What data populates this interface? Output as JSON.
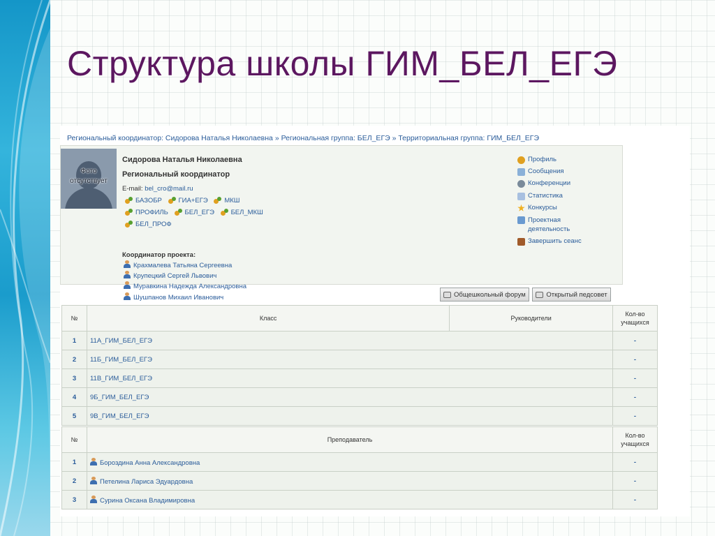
{
  "slide_title": "Структура школы ГИМ_БЕЛ_ЕГЭ",
  "breadcrumb": "Региональный координатор: Сидорова Наталья Николаевна » Региональная группа: БЕЛ_ЕГЭ » Территориальная группа: ГИМ_БЕЛ_ЕГЭ",
  "photo_caption_1": "Фото",
  "photo_caption_2": "отсутствует",
  "profile": {
    "name": "Сидорова Наталья Николаевна",
    "role": "Региональный координатор",
    "email_label": "E-mail: ",
    "email": "bel_cro@mail.ru",
    "groups": [
      "БАЗОБР",
      "ГИА+ЕГЭ",
      "МКШ",
      "ПРОФИЛЬ",
      "БЕЛ_ЕГЭ",
      "БЕЛ_МКШ",
      "БЕЛ_ПРОФ"
    ],
    "coordinators_heading": "Координатор проекта:",
    "coordinators": [
      "Крахмалева Татьяна Сергеевна",
      "Крупецкий Сергей Львович",
      "Муравкина Надежда Александровна",
      "Шушпанов Михаил Иванович"
    ]
  },
  "menu": [
    {
      "label": "Профиль",
      "icon": "person-icon",
      "color": "#e0a020"
    },
    {
      "label": "Сообщения",
      "icon": "envelope-icon",
      "color": "#8ab0d8"
    },
    {
      "label": "Конференции",
      "icon": "conference-icon",
      "color": "#7a8a9a"
    },
    {
      "label": "Статистика",
      "icon": "chart-icon",
      "color": "#a8c0e0"
    },
    {
      "label": "Конкурсы",
      "icon": "star-icon",
      "color": "#f0b020"
    },
    {
      "label": "Проектная\nдеятельность",
      "icon": "document-icon",
      "color": "#6a9ad0"
    },
    {
      "label": "Завершить сеанс",
      "icon": "logout-icon",
      "color": "#a05a2a"
    }
  ],
  "buttons": {
    "school_forum": "Общешкольный форум",
    "open_council": "Открытый педсовет"
  },
  "classes_table": {
    "col_num": "№",
    "col_class": "Класс",
    "col_leaders": "Руководители",
    "col_count_1": "Кол-во",
    "col_count_2": "учащихся",
    "rows": [
      {
        "num": "1",
        "name": "11А_ГИМ_БЕЛ_ЕГЭ",
        "count": "-"
      },
      {
        "num": "2",
        "name": "11Б_ГИМ_БЕЛ_ЕГЭ",
        "count": "-"
      },
      {
        "num": "3",
        "name": "11В_ГИМ_БЕЛ_ЕГЭ",
        "count": "-"
      },
      {
        "num": "4",
        "name": "9Б_ГИМ_БЕЛ_ЕГЭ",
        "count": "-"
      },
      {
        "num": "5",
        "name": "9В_ГИМ_БЕЛ_ЕГЭ",
        "count": "-"
      }
    ]
  },
  "teachers_table": {
    "col_num": "№",
    "col_teacher": "Преподаватель",
    "col_count_1": "Кол-во",
    "col_count_2": "учащихся",
    "rows": [
      {
        "num": "1",
        "name": "Бороздина Анна Александровна",
        "count": "-"
      },
      {
        "num": "2",
        "name": "Петелина Лариса Эдуардовна",
        "count": "-"
      },
      {
        "num": "3",
        "name": "Сурина Оксана Владимировна",
        "count": "-"
      }
    ]
  }
}
